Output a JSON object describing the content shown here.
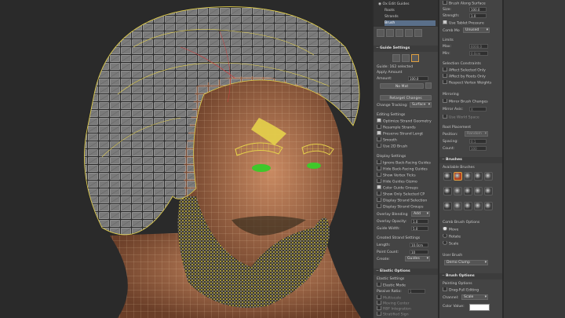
{
  "modifier_tree": {
    "root": "Ox Edit Guides",
    "items": [
      "Roots",
      "Strands",
      "Brush"
    ]
  },
  "guide_settings": {
    "title": "Guide Settings",
    "selected_count": "Guide: 162 selected",
    "apply_amount_label": "Apply Amount",
    "amount_label": "Amount:",
    "amount_value": "100.0",
    "no_mat_label": "No Mat",
    "retarget_label": "Retarget Changes",
    "change_tracking_label": "Change Tracking:",
    "change_tracking_value": "Surface"
  },
  "editing_settings": {
    "title": "Editing Settings",
    "options": [
      {
        "label": "Optimize Strand Geometry",
        "checked": true
      },
      {
        "label": "Resample Strands",
        "checked": false
      },
      {
        "label": "Preserve Strand Lengt",
        "checked": true
      },
      {
        "label": "Smooth",
        "checked": false
      },
      {
        "label": "Use 2D Brush",
        "checked": false
      }
    ]
  },
  "display_settings": {
    "title": "Display Settings",
    "options": [
      {
        "label": "Ignore Back-Facing Guides",
        "checked": false
      },
      {
        "label": "Hide Back-Facing Guides",
        "checked": false
      },
      {
        "label": "Show Vertex Ticks",
        "checked": false
      },
      {
        "label": "Hide Guides Gizmo",
        "checked": false
      },
      {
        "label": "Color Guide Groups",
        "checked": true
      },
      {
        "label": "Show Only Selected CP",
        "checked": false
      },
      {
        "label": "Display Strand Selection",
        "checked": false
      },
      {
        "label": "Display Strand Groups",
        "checked": false
      }
    ],
    "overlay_blending_label": "Overlay Blending:",
    "overlay_blending_value": "Add",
    "overlay_opacity_label": "Overlay Opacity:",
    "overlay_opacity_value": "1.0",
    "guide_width_label": "Guide Width:",
    "guide_width_value": "5.0"
  },
  "created_strand_settings": {
    "title": "Created Strand Settings",
    "length_label": "Length:",
    "length_value": "10.0cm",
    "point_count_label": "Point Count:",
    "point_count_value": "10",
    "create_label": "Create:",
    "create_value": "Guides"
  },
  "elastic_options": {
    "title": "Elastic Options",
    "settings_label": "Elastic Settings",
    "elastic_mode_label": "Elastic Mode",
    "passive_ratio_label": "Passive Ratio:",
    "passive_ratio_value": "1",
    "sub_options": [
      "Multiscale",
      "Moving Center",
      "RBF Integration",
      "Stratified Sign"
    ]
  },
  "brush_settings": {
    "brush_along_surface": "Brush Along Surface",
    "size_label": "Size:",
    "size_value": "100.0",
    "strength_label": "Strength:",
    "strength_value": "1.0",
    "use_tablet_pressure": "Use Tablet Pressure",
    "comb_mode_label": "Comb Mo",
    "comb_mode_value": "Unused",
    "limits_label": "Limits",
    "max_label": "Max:",
    "max_value": "6000.0",
    "min_label": "Min:",
    "min_value": "0.0cm",
    "selection_constraints_label": "Selection Constraints",
    "constraints": [
      {
        "label": "Affect Selected Only",
        "checked": false
      },
      {
        "label": "Affect by Roots Only",
        "checked": false
      },
      {
        "label": "Respect Vertex Weights",
        "checked": false
      }
    ],
    "mirroring_label": "Mirroring",
    "mirror_brush_label": "Mirror Brush Changes",
    "mirror_axis_label": "Mirror Axis:",
    "mirror_axis_value": "X",
    "use_world_space": "Use World Space",
    "root_placement_label": "Root Placement",
    "position_label": "Position:",
    "position_value": "Random",
    "spacing_label": "Spacing:",
    "spacing_value": "0.1",
    "count_label": "Count:",
    "count_value": "100"
  },
  "brushes": {
    "title": "Brushes",
    "available_label": "Available Brushes",
    "count": 15,
    "selected_index": 1
  },
  "comb_brush_options": {
    "title": "Comb Brush Options",
    "options": [
      {
        "label": "Move",
        "selected": true
      },
      {
        "label": "Rotate",
        "selected": false
      },
      {
        "label": "Scale",
        "selected": false
      }
    ]
  },
  "user_brush": {
    "title": "User Brush",
    "value": "Demo Clump"
  },
  "brush_options": {
    "title": "Brush Options",
    "painting_options_label": "Painting Options",
    "drag_full_editing_label": "Drag-Full Editing",
    "channel_label": "Channel:",
    "channel_value": "Scale",
    "color_value_label": "Color Value:",
    "color_value": "#ffffff"
  },
  "colors": {
    "guide_yellow": "#e6d24a",
    "eye_green": "#3fc82a",
    "skin": "#b87a55",
    "wire_grey": "#d8d8d8"
  }
}
